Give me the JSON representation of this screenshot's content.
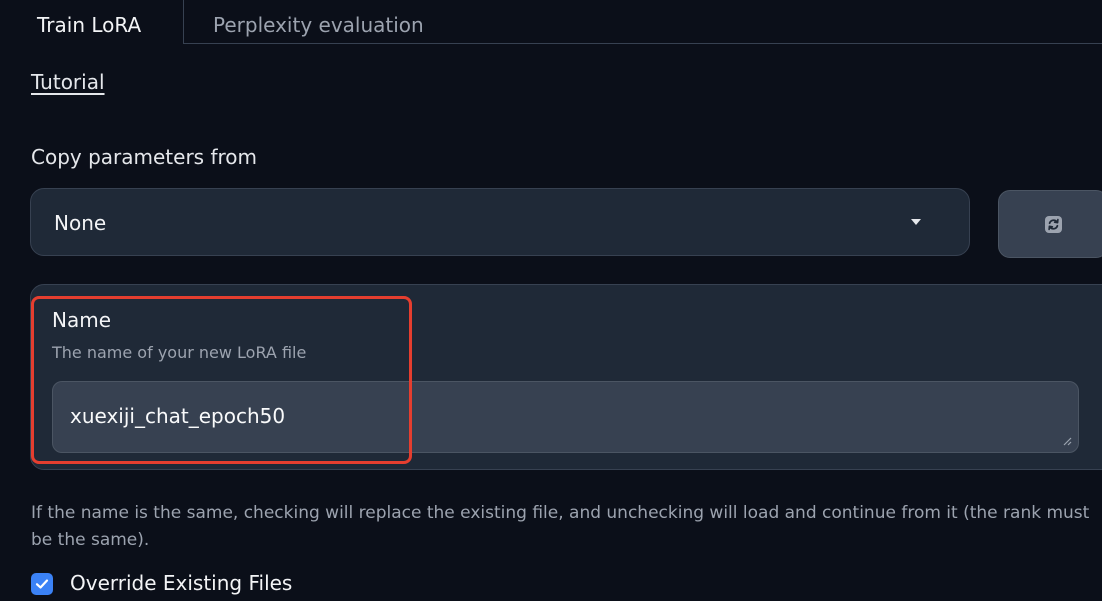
{
  "tabs": [
    {
      "label": "Train LoRA",
      "active": true
    },
    {
      "label": "Perplexity evaluation",
      "active": false
    }
  ],
  "tutorial": {
    "label": "Tutorial"
  },
  "copy_params": {
    "label": "Copy parameters from",
    "selected": "None",
    "caret_icon": "chevron-down-icon",
    "refresh_icon": "refresh-icon"
  },
  "name_field": {
    "label": "Name",
    "info": "The name of your new LoRA file",
    "value": "xuexiji_chat_epoch50"
  },
  "override": {
    "description": "If the name is the same, checking will replace the existing file, and unchecking will load and continue from it (the rank must be the same).",
    "checkbox_label": "Override Existing Files",
    "checked": true
  },
  "colors": {
    "background": "#0b0f19",
    "panel": "#1f2937",
    "input": "#374151",
    "accent": "#3b82f6",
    "highlight": "#e53e2f"
  }
}
